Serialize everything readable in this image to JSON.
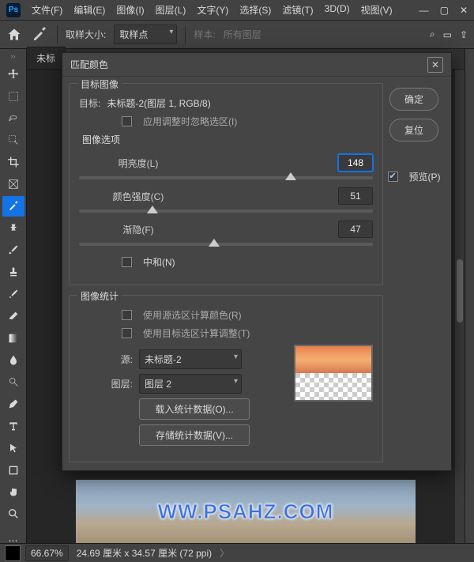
{
  "menu": {
    "items": [
      "文件(F)",
      "编辑(E)",
      "图像(I)",
      "图层(L)",
      "文字(Y)",
      "选择(S)",
      "滤镜(T)",
      "3D(D)",
      "视图(V)"
    ]
  },
  "optionbar": {
    "sample_size_label": "取样大小:",
    "sample_size_value": "取样点",
    "sample_label": "样本:",
    "sample_value": "所有图层"
  },
  "tab": {
    "title": "未标"
  },
  "statusbar": {
    "zoom": "66.67%",
    "dims": "24.69 厘米 x 34.57 厘米 (72 ppi)"
  },
  "watermark": "WW.PSAHZ.COM",
  "dialog": {
    "title": "匹配颜色",
    "ok": "确定",
    "reset": "复位",
    "preview": "预览(P)",
    "target_section": "目标图像",
    "target_label": "目标:",
    "target_value": "未标题-2(图层 1, RGB/8)",
    "ignore_sel": "应用调整时忽略选区(I)",
    "image_options": "图像选项",
    "luminance": {
      "label": "明亮度(L)",
      "value": "148"
    },
    "intensity": {
      "label": "颜色强度(C)",
      "value": "51"
    },
    "fade": {
      "label": "渐隐(F)",
      "value": "47"
    },
    "neutral": "中和(N)",
    "stats_section": "图像统计",
    "use_src_sel": "使用源选区计算颜色(R)",
    "use_tgt_sel": "使用目标选区计算调整(T)",
    "source_label": "源:",
    "source_value": "未标题-2",
    "layer_label": "图层:",
    "layer_value": "图层 2",
    "load_stats": "载入统计数据(O)...",
    "save_stats": "存储统计数据(V)..."
  }
}
